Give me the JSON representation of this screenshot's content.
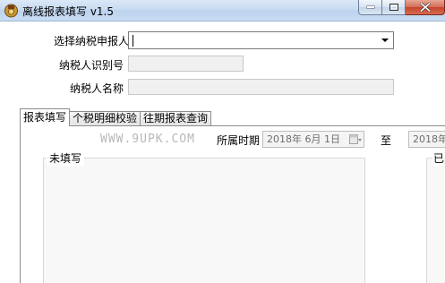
{
  "window": {
    "title": "离线报表填写 v1.5",
    "icons": {
      "app": "tax-badge-icon",
      "minimize": "minimize-icon",
      "maximize": "maximize-icon",
      "close": "close-icon"
    }
  },
  "form": {
    "taxpayer_select_label": "选择纳税申报人",
    "taxpayer_select_value": "",
    "taxpayer_id_label": "纳税人识别号",
    "taxpayer_id_value": "",
    "taxpayer_name_label": "纳税人名称",
    "taxpayer_name_value": ""
  },
  "tabs": [
    {
      "label": "报表填写",
      "active": true
    },
    {
      "label": "个税明细校验",
      "active": false
    },
    {
      "label": "往期报表查询",
      "active": false
    }
  ],
  "panel": {
    "watermark": "WWW.9UPK.COM",
    "period_label": "所属时期",
    "date_from": "2018年 6月 1日",
    "to_label": "至",
    "date_to": "2018年",
    "unfilled_label": "未填写",
    "filled_label": "已"
  },
  "colors": {
    "titlebar": "#c6d9f0",
    "close_button": "#c4432c",
    "disabled_field": "#f0f0f0"
  }
}
